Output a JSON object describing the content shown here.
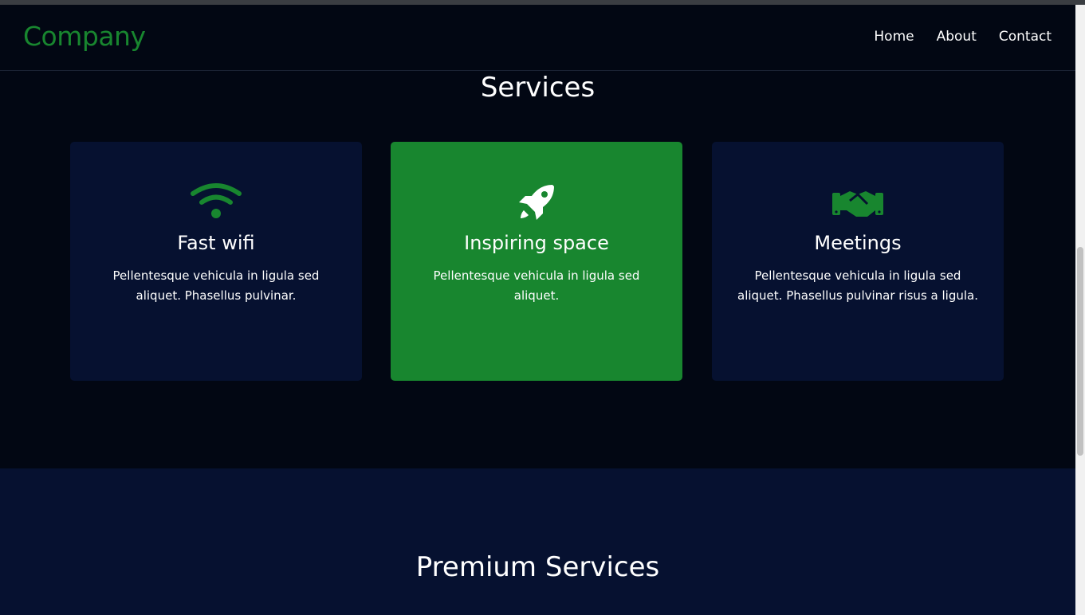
{
  "nav": {
    "brand": "Company",
    "links": [
      "Home",
      "About",
      "Contact"
    ]
  },
  "services": {
    "title": "Services",
    "cards": [
      {
        "icon": "wifi-icon",
        "title": "Fast wifi",
        "text": "Pellentesque vehicula in ligula sed aliquet. Phasellus pulvinar.",
        "active": false
      },
      {
        "icon": "rocket-icon",
        "title": "Inspiring space",
        "text": "Pellentesque vehicula in ligula sed aliquet.",
        "active": true
      },
      {
        "icon": "handshake-icon",
        "title": "Meetings",
        "text": "Pellentesque vehicula in ligula sed aliquet. Phasellus pulvinar risus a ligula.",
        "active": false
      }
    ]
  },
  "premium": {
    "title": "Premium Services"
  },
  "colors": {
    "accent": "#18862f",
    "background": "#020713",
    "card": "#061130"
  }
}
